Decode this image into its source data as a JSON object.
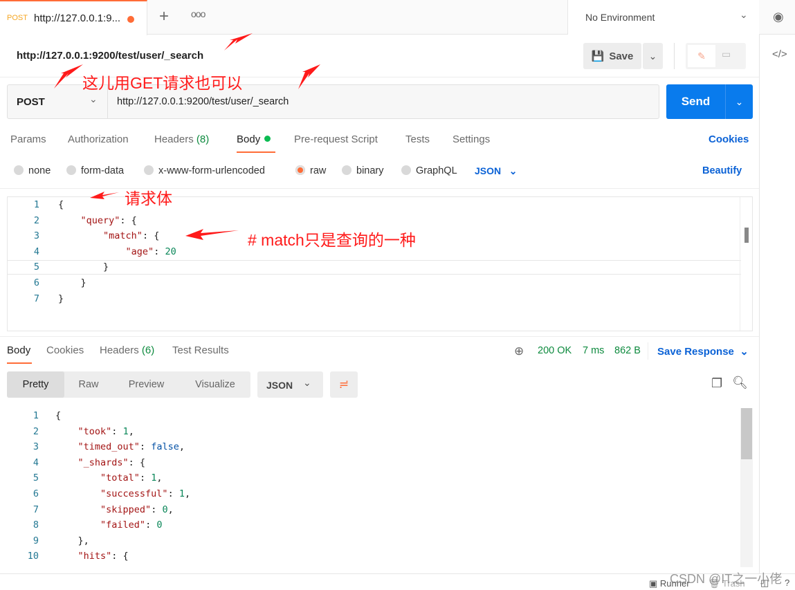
{
  "tab": {
    "method": "POST",
    "title": "http://127.0.0.1:9..."
  },
  "environment": "No Environment",
  "request": {
    "name": "http://127.0.0.1:9200/test/user/_search",
    "save_label": "Save",
    "method": "POST",
    "url": "http://127.0.0.1:9200/test/user/_search",
    "send_label": "Send"
  },
  "req_tabs": [
    {
      "label": "Params"
    },
    {
      "label": "Authorization"
    },
    {
      "label": "Headers",
      "count": "(8)"
    },
    {
      "label": "Body"
    },
    {
      "label": "Pre-request Script"
    },
    {
      "label": "Tests"
    },
    {
      "label": "Settings"
    }
  ],
  "cookies_link": "Cookies",
  "body_types": [
    "none",
    "form-data",
    "x-www-form-urlencoded",
    "raw",
    "binary",
    "GraphQL"
  ],
  "body_format": "JSON",
  "beautify": "Beautify",
  "request_body": [
    [
      [
        "p",
        "{"
      ]
    ],
    [
      [
        "p",
        "    "
      ],
      [
        "k",
        "\"query\""
      ],
      [
        "p",
        ": {"
      ]
    ],
    [
      [
        "p",
        "        "
      ],
      [
        "k",
        "\"match\""
      ],
      [
        "p",
        ": {"
      ]
    ],
    [
      [
        "p",
        "            "
      ],
      [
        "k",
        "\"age\""
      ],
      [
        "p",
        ": "
      ],
      [
        "n",
        "20"
      ]
    ],
    [
      [
        "p",
        "        }"
      ]
    ],
    [
      [
        "p",
        "    }"
      ]
    ],
    [
      [
        "p",
        "}"
      ]
    ]
  ],
  "res_tabs": [
    {
      "label": "Body"
    },
    {
      "label": "Cookies"
    },
    {
      "label": "Headers",
      "count": "(6)"
    },
    {
      "label": "Test Results"
    }
  ],
  "status": {
    "code": "200 OK",
    "time": "7 ms",
    "size": "862 B",
    "save_response": "Save Response"
  },
  "view_modes": [
    "Pretty",
    "Raw",
    "Preview",
    "Visualize"
  ],
  "res_format": "JSON",
  "response_body": [
    [
      [
        "p",
        "{"
      ]
    ],
    [
      [
        "p",
        "    "
      ],
      [
        "k",
        "\"took\""
      ],
      [
        "p",
        ": "
      ],
      [
        "n",
        "1"
      ],
      [
        "p",
        ","
      ]
    ],
    [
      [
        "p",
        "    "
      ],
      [
        "k",
        "\"timed_out\""
      ],
      [
        "p",
        ": "
      ],
      [
        "b",
        "false"
      ],
      [
        "p",
        ","
      ]
    ],
    [
      [
        "p",
        "    "
      ],
      [
        "k",
        "\"_shards\""
      ],
      [
        "p",
        ": {"
      ]
    ],
    [
      [
        "p",
        "        "
      ],
      [
        "k",
        "\"total\""
      ],
      [
        "p",
        ": "
      ],
      [
        "n",
        "1"
      ],
      [
        "p",
        ","
      ]
    ],
    [
      [
        "p",
        "        "
      ],
      [
        "k",
        "\"successful\""
      ],
      [
        "p",
        ": "
      ],
      [
        "n",
        "1"
      ],
      [
        "p",
        ","
      ]
    ],
    [
      [
        "p",
        "        "
      ],
      [
        "k",
        "\"skipped\""
      ],
      [
        "p",
        ": "
      ],
      [
        "n",
        "0"
      ],
      [
        "p",
        ","
      ]
    ],
    [
      [
        "p",
        "        "
      ],
      [
        "k",
        "\"failed\""
      ],
      [
        "p",
        ": "
      ],
      [
        "n",
        "0"
      ]
    ],
    [
      [
        "p",
        "    },"
      ]
    ],
    [
      [
        "p",
        "    "
      ],
      [
        "k",
        "\"hits\""
      ],
      [
        "p",
        ": {"
      ]
    ]
  ],
  "footer": {
    "runner": "Runner",
    "trash": "Trash",
    "watermark": "CSDN @IT之一小佬"
  },
  "annotations": {
    "get_note": "这儿用GET请求也可以",
    "body_note": "请求体",
    "match_note": "# match只是查询的一种"
  },
  "colors": {
    "accent": "#ff6c37",
    "send": "#097bed",
    "link": "#0b62d6",
    "status": "#0d8a3e",
    "annotation": "#ff1a1a"
  }
}
